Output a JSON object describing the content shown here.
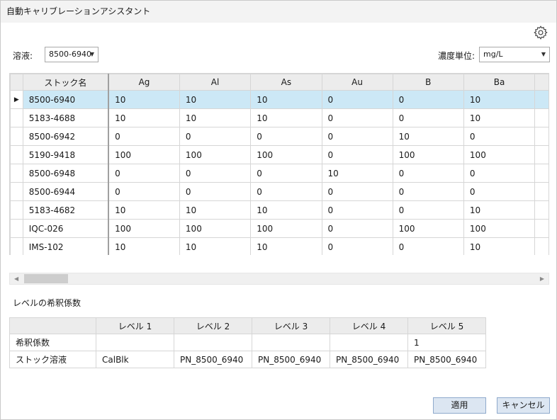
{
  "window": {
    "title": "自動キャリブレーションアシスタント"
  },
  "solution": {
    "label": "溶液:",
    "selected": "8500-6940"
  },
  "units": {
    "label": "濃度単位:",
    "selected": "mg/L"
  },
  "stock_grid": {
    "columns": [
      "ストック名",
      "Ag",
      "Al",
      "As",
      "Au",
      "B",
      "Ba"
    ],
    "selected_row": 0,
    "rows": [
      {
        "name": "8500-6940",
        "values": [
          "10",
          "10",
          "10",
          "0",
          "0",
          "10"
        ]
      },
      {
        "name": "5183-4688",
        "values": [
          "10",
          "10",
          "10",
          "0",
          "0",
          "10"
        ]
      },
      {
        "name": "8500-6942",
        "values": [
          "0",
          "0",
          "0",
          "0",
          "10",
          "0"
        ]
      },
      {
        "name": "5190-9418",
        "values": [
          "100",
          "100",
          "100",
          "0",
          "100",
          "100"
        ]
      },
      {
        "name": "8500-6948",
        "values": [
          "0",
          "0",
          "0",
          "10",
          "0",
          "0"
        ]
      },
      {
        "name": "8500-6944",
        "values": [
          "0",
          "0",
          "0",
          "0",
          "0",
          "0"
        ]
      },
      {
        "name": "5183-4682",
        "values": [
          "10",
          "10",
          "10",
          "0",
          "0",
          "10"
        ]
      },
      {
        "name": "IQC-026",
        "values": [
          "100",
          "100",
          "100",
          "0",
          "100",
          "100"
        ]
      },
      {
        "name": "IMS-102",
        "values": [
          "10",
          "10",
          "10",
          "0",
          "0",
          "10"
        ]
      }
    ]
  },
  "dilution": {
    "section_title": "レベルの希釈係数",
    "columns": [
      "",
      "レベル 1",
      "レベル 2",
      "レベル 3",
      "レベル 4",
      "レベル 5"
    ],
    "rows": [
      {
        "label": "希釈係数",
        "values": [
          "",
          "",
          "",
          "",
          "1"
        ]
      },
      {
        "label": "ストック溶液",
        "values": [
          "CalBlk",
          "PN_8500_6940",
          "PN_8500_6940",
          "PN_8500_6940",
          "PN_8500_6940"
        ]
      }
    ]
  },
  "buttons": {
    "apply": "適用",
    "cancel": "キャンセル"
  },
  "icons": {
    "settings": "gear-icon",
    "row_pointer": "▶",
    "dropdown": "▼",
    "scroll_left": "◀",
    "scroll_right": "▶"
  },
  "colors": {
    "selected_row": "#cce8f6",
    "header_bg": "#ececec",
    "button_bg": "#dce6f2"
  }
}
